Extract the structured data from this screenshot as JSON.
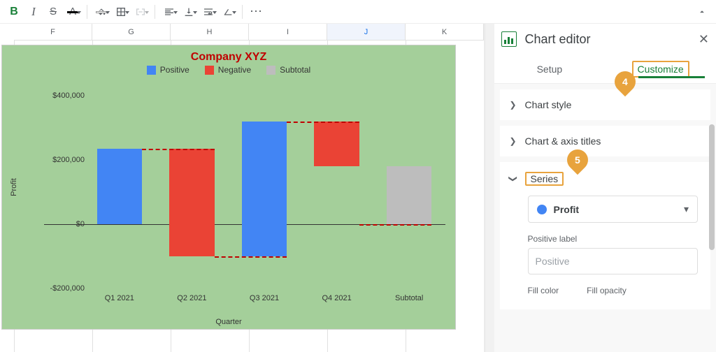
{
  "toolbar": {
    "bold": "B",
    "italic": "I",
    "strike": "S",
    "color": "A",
    "more": "⋯"
  },
  "sheet": {
    "visible_columns": [
      "F",
      "G",
      "H",
      "I",
      "J",
      "K"
    ]
  },
  "chart_data": {
    "type": "bar",
    "title": "Company XYZ",
    "xlabel": "Quarter",
    "ylabel": "Profit",
    "ylim": [
      -200000,
      400000
    ],
    "yticks": [
      -200000,
      0,
      200000,
      400000
    ],
    "ytick_labels": [
      "-$200,000",
      "$0",
      "$200,000",
      "$400,000"
    ],
    "categories": [
      "Q1 2021",
      "Q2 2021",
      "Q3 2021",
      "Q4 2021",
      "Subtotal"
    ],
    "waterfall": [
      {
        "category": "Q1 2021",
        "start": 0,
        "end": 234000,
        "kind": "positive"
      },
      {
        "category": "Q2 2021",
        "start": 234000,
        "end": -100000,
        "kind": "negative"
      },
      {
        "category": "Q3 2021",
        "start": -100000,
        "end": 320000,
        "kind": "positive"
      },
      {
        "category": "Q4 2021",
        "start": 320000,
        "end": 180000,
        "kind": "negative"
      },
      {
        "category": "Subtotal",
        "start": 0,
        "end": 180000,
        "kind": "subtotal"
      }
    ],
    "legend": [
      {
        "label": "Positive",
        "color": "#4285f4"
      },
      {
        "label": "Negative",
        "color": "#ea4335"
      },
      {
        "label": "Subtotal",
        "color": "#bdbdbd"
      }
    ]
  },
  "panel": {
    "title": "Chart editor",
    "tabs": {
      "setup": "Setup",
      "customize": "Customize",
      "active": "customize"
    },
    "sections": {
      "chart_style": "Chart style",
      "chart_axis_titles": "Chart & axis titles",
      "series": "Series"
    },
    "series": {
      "selected": "Profit",
      "positive_label_label": "Positive label",
      "positive_placeholder": "Positive",
      "fill_color_label": "Fill color",
      "fill_opacity_label": "Fill opacity"
    }
  },
  "callouts": {
    "c4": "4",
    "c5": "5"
  }
}
